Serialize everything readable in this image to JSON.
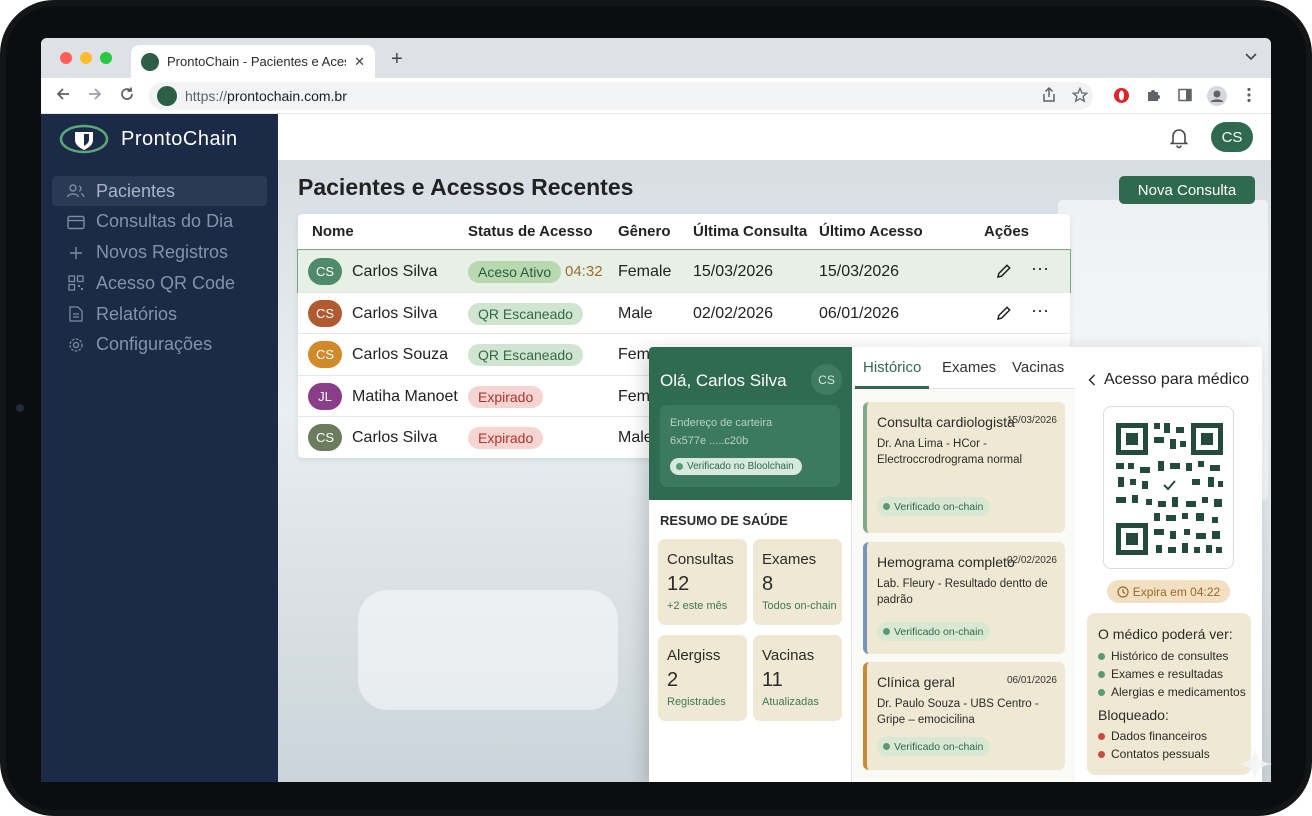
{
  "browser": {
    "tab_title": "ProntoChain - Pacientes e Acessos",
    "tab_close": "✕",
    "new_tab": "+",
    "url_scheme": "https://",
    "url_host": "prontochain.com.br"
  },
  "app": {
    "brand": "ProntoChain",
    "user_initials": "CS"
  },
  "sidebar": {
    "items": [
      {
        "label": "Pacientes",
        "icon": "users-icon"
      },
      {
        "label": "Consultas do Dia",
        "icon": "calendar-icon"
      },
      {
        "label": "Novos Registros",
        "icon": "plus-icon"
      },
      {
        "label": "Acesso QR Code",
        "icon": "qr-icon"
      },
      {
        "label": "Relatórios",
        "icon": "document-icon"
      },
      {
        "label": "Configurações",
        "icon": "gear-icon"
      }
    ]
  },
  "main": {
    "title": "Pacientes e Acessos Recentes",
    "new_button": "Nova Consulta"
  },
  "table": {
    "columns": [
      "Nome",
      "Status de Acesso",
      "Gênero",
      "Última Consulta",
      "Último Acesso",
      "Ações"
    ],
    "rows": [
      {
        "initials": "CS",
        "avatar_color": "#4f8a6d",
        "name": "Carlos Silva",
        "status": "Aceso Ativo",
        "status_style": "green",
        "timer": "04:32",
        "gender": "Female",
        "last_consult": "15/03/2026",
        "last_access": "15/03/2026"
      },
      {
        "initials": "CS",
        "avatar_color": "#b05a30",
        "name": "Carlos Silva",
        "status": "QR Escaneado",
        "status_style": "mint",
        "timer": "",
        "gender": "Male",
        "last_consult": "02/02/2026",
        "last_access": "06/01/2026"
      },
      {
        "initials": "CS",
        "avatar_color": "#d08a2a",
        "name": "Carlos Souza",
        "status": "QR Escaneado",
        "status_style": "mint",
        "timer": "",
        "gender": "Fem",
        "last_consult": "",
        "last_access": ""
      },
      {
        "initials": "JL",
        "avatar_color": "#8a3e8a",
        "name": "Matiha Manoet",
        "status": "Expirado",
        "status_style": "red",
        "timer": "",
        "gender": "Fem",
        "last_consult": "",
        "last_access": ""
      },
      {
        "initials": "CS",
        "avatar_color": "#6b7d5e",
        "name": "Carlos Silva",
        "status": "Expirado",
        "status_style": "red",
        "timer": "",
        "gender": "Male",
        "last_consult": "",
        "last_access": ""
      }
    ]
  },
  "patient_app": {
    "greeting": "Olá, Carlos Silva",
    "avatar": "CS",
    "wallet_label": "Endereço de carteira",
    "wallet_address": "6x577e .....c20b",
    "wallet_verified": "Verificado no Bloolchain",
    "summary_title": "RESUMO DE SAÚDE",
    "stats": [
      {
        "label": "Consultas",
        "value": "12",
        "sub": "+2 este mês"
      },
      {
        "label": "Exames",
        "value": "8",
        "sub": "Todos on-chain"
      },
      {
        "label": "Alergiss",
        "value": "2",
        "sub": "Registrades"
      },
      {
        "label": "Vacinas",
        "value": "11",
        "sub": "Atualizadas"
      }
    ],
    "tabs": [
      "Histórico",
      "Exames",
      "Vacinas"
    ],
    "history": [
      {
        "title": "Consulta cardiologista",
        "date": "15/03/2026",
        "desc": "Dr. Ana Lima - HCor - Electroccrodrograma normal",
        "verified": "Verificado on-chain"
      },
      {
        "title": "Hemograma completo",
        "date": "02/02/2026",
        "desc": "Lab. Fleury - Resultado dentto de padrão",
        "verified": "Verificado on-chain"
      },
      {
        "title": "Clínica geral",
        "date": "06/01/2026",
        "desc": "Dr. Paulo Souza - UBS Centro - Gripe – emocicilina",
        "verified": "Verificado on-chain"
      }
    ],
    "access_title": "Acesso para médico",
    "expires": "Expira em 04:22",
    "can_see_title": "O médico poderá ver:",
    "can_see": [
      "Histórico de consultes",
      "Exames e resultadas",
      "Alergias e medicamentos"
    ],
    "blocked_title": "Bloqueado:",
    "blocked": [
      "Dados financeiros",
      "Contatos pessuals"
    ]
  }
}
